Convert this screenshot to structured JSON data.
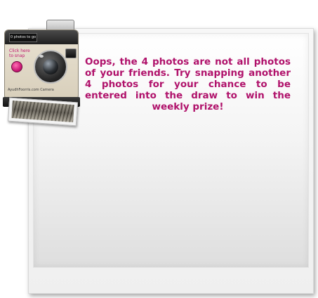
{
  "message": {
    "text": "Oops, the 4 photos are not all photos of your friends. Try snapping another 4 photos for your chance to be entered into the draw to win the weekly prize!",
    "color": "#b0126b"
  },
  "camera": {
    "counter_text": "0 photos to go",
    "click_label": "Click here to snap",
    "brand_label": "AyudhFoorris.com Camera",
    "button_color": "#cc1a77"
  }
}
